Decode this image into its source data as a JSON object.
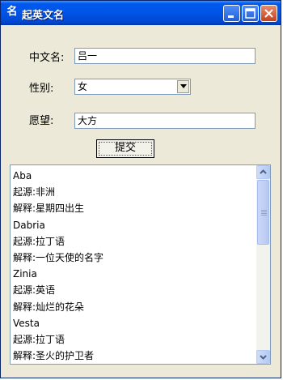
{
  "window": {
    "title_icon": "名",
    "title": "起英文名",
    "minimize_icon": "minimize-icon",
    "maximize_icon": "maximize-icon",
    "close_icon": "close-icon"
  },
  "form": {
    "chinese_name_label": "中文名:",
    "chinese_name_value": "吕一",
    "gender_label": "性别:",
    "gender_selected": "女",
    "wish_label": "愿望:",
    "wish_value": "大方",
    "submit_label": "提交"
  },
  "results": {
    "lines": [
      "Aba",
      "起源:非洲",
      "解释:星期四出生",
      "Dabria",
      "起源:拉丁语",
      "解释:一位天使的名字",
      "Zinia",
      "起源:英语",
      "解释:灿烂的花朵",
      "Vesta",
      "起源:拉丁语",
      "解释:圣火的护卫者"
    ]
  },
  "colors": {
    "titlebar": "#0055e5",
    "window_bg": "#ece9d8",
    "close_button": "#c5401e"
  }
}
